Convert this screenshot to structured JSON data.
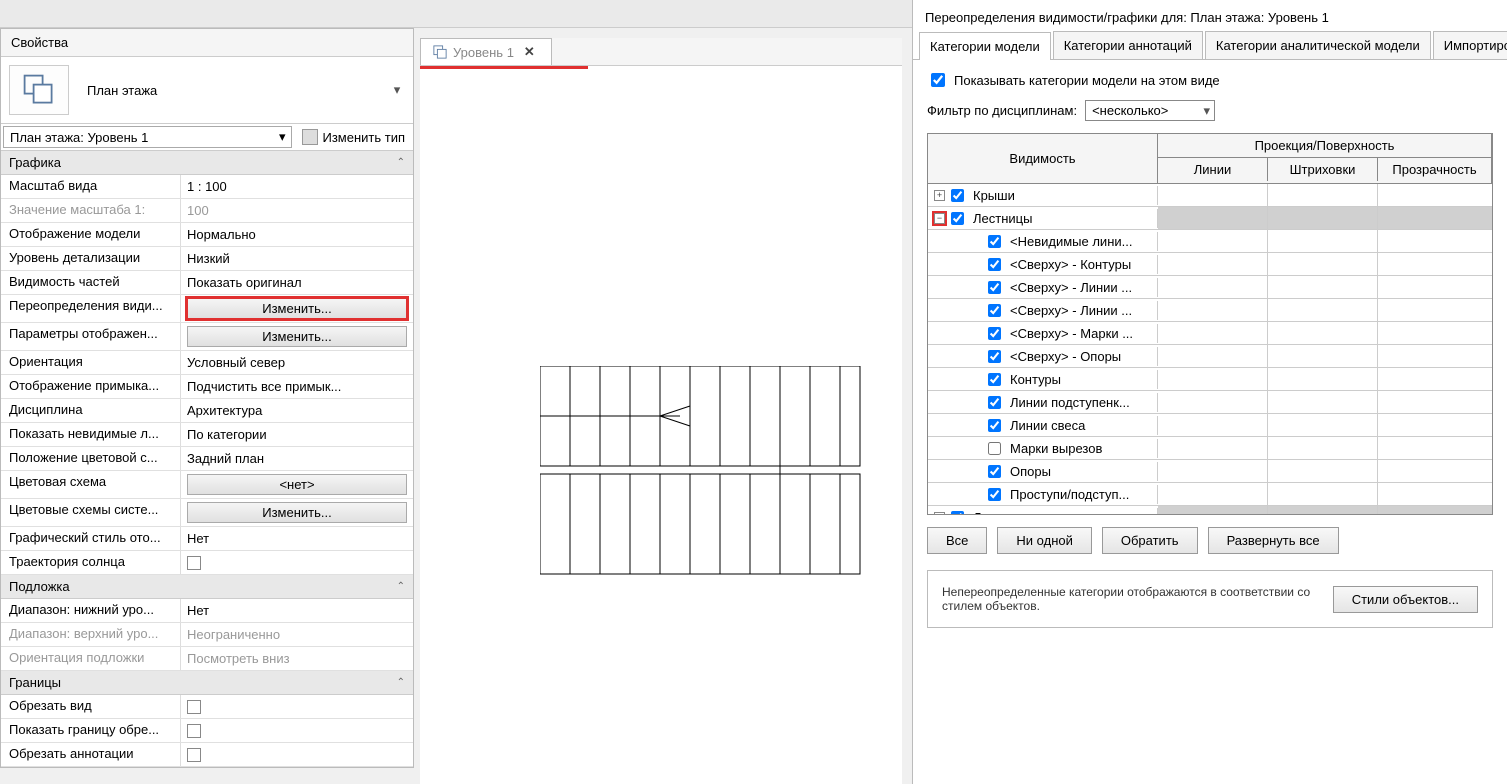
{
  "properties": {
    "panel_title": "Свойства",
    "type_label": "План этажа",
    "view_selector": "План этажа: Уровень 1",
    "edit_type": "Изменить тип",
    "sections": {
      "graphics": "Графика",
      "underlay": "Подложка",
      "bounds": "Границы"
    },
    "rows": {
      "scale": {
        "label": "Масштаб вида",
        "value": "1 : 100"
      },
      "scale_val": {
        "label": "Значение масштаба    1:",
        "value": "100"
      },
      "model_disp": {
        "label": "Отображение модели",
        "value": "Нормально"
      },
      "detail": {
        "label": "Уровень детализации",
        "value": "Низкий"
      },
      "parts_vis": {
        "label": "Видимость частей",
        "value": "Показать оригинал"
      },
      "vis_override": {
        "label": "Переопределения види...",
        "button": "Изменить..."
      },
      "disp_params": {
        "label": "Параметры отображен...",
        "button": "Изменить..."
      },
      "orientation": {
        "label": "Ориентация",
        "value": "Условный север"
      },
      "join_disp": {
        "label": "Отображение примыка...",
        "value": "Подчистить все примык..."
      },
      "discipline": {
        "label": "Дисциплина",
        "value": "Архитектура"
      },
      "hidden_lines": {
        "label": "Показать невидимые л...",
        "value": "По категории"
      },
      "color_pos": {
        "label": "Положение цветовой с...",
        "value": "Задний план"
      },
      "color_scheme": {
        "label": "Цветовая схема",
        "button": "<нет>"
      },
      "sys_colors": {
        "label": "Цветовые схемы систе...",
        "button": "Изменить..."
      },
      "graphic_style": {
        "label": "Графический стиль ото...",
        "value": "Нет"
      },
      "sun_path": {
        "label": "Траектория солнца"
      },
      "under_bottom": {
        "label": "Диапазон: нижний уро...",
        "value": "Нет"
      },
      "under_top": {
        "label": "Диапазон: верхний уро...",
        "value": "Неограниченно"
      },
      "under_orient": {
        "label": "Ориентация подложки",
        "value": "Посмотреть вниз"
      },
      "crop_view": {
        "label": "Обрезать вид"
      },
      "crop_bound": {
        "label": "Показать границу обре..."
      },
      "crop_annot": {
        "label": "Обрезать аннотации"
      }
    }
  },
  "tab": {
    "label": "Уровень 1"
  },
  "dialog": {
    "title": "Переопределения видимости/графики для: План этажа: Уровень 1",
    "tabs": [
      "Категории модели",
      "Категории аннотаций",
      "Категории аналитической модели",
      "Импортированные к"
    ],
    "show_label": "Показывать категории модели на этом виде",
    "filter_label": "Фильтр по дисциплинам:",
    "filter_value": "<несколько>",
    "headers": {
      "visibility": "Видимость",
      "projection": "Проекция/Поверхность",
      "lines": "Линии",
      "hatch": "Штриховки",
      "trans": "Прозрачность"
    },
    "categories": [
      {
        "name": "Крыши",
        "expand": "plus",
        "indent": 0,
        "checked": true,
        "dark": false
      },
      {
        "name": "Лестницы",
        "expand": "minus",
        "indent": 0,
        "checked": true,
        "dark": true,
        "hl": true
      },
      {
        "name": "<Невидимые лини...",
        "indent": 2,
        "checked": true,
        "dark": false
      },
      {
        "name": "<Сверху> - Контуры",
        "indent": 2,
        "checked": true,
        "dark": false
      },
      {
        "name": "<Сверху> - Линии ...",
        "indent": 2,
        "checked": true,
        "dark": false
      },
      {
        "name": "<Сверху> - Линии ...",
        "indent": 2,
        "checked": true,
        "dark": false
      },
      {
        "name": "<Сверху> - Марки ...",
        "indent": 2,
        "checked": true,
        "dark": false
      },
      {
        "name": "<Сверху> - Опоры",
        "indent": 2,
        "checked": true,
        "dark": false
      },
      {
        "name": "Контуры",
        "indent": 2,
        "checked": true,
        "dark": false
      },
      {
        "name": "Линии подступенк...",
        "indent": 2,
        "checked": true,
        "dark": false
      },
      {
        "name": "Линии свеса",
        "indent": 2,
        "checked": true,
        "dark": false
      },
      {
        "name": "Марки вырезов",
        "indent": 2,
        "checked": false,
        "dark": false
      },
      {
        "name": "Опоры",
        "indent": 2,
        "checked": true,
        "dark": false
      },
      {
        "name": "Проступи/подступ...",
        "indent": 2,
        "checked": true,
        "dark": false
      },
      {
        "name": "Линии",
        "expand": "plus",
        "indent": 0,
        "checked": true,
        "dark": true
      }
    ],
    "buttons": {
      "all": "Все",
      "none": "Ни одной",
      "invert": "Обратить",
      "expand": "Развернуть все"
    },
    "note": "Непереопределенные категории отображаются в соответствии со стилем объектов.",
    "styles_btn": "Стили объектов..."
  }
}
